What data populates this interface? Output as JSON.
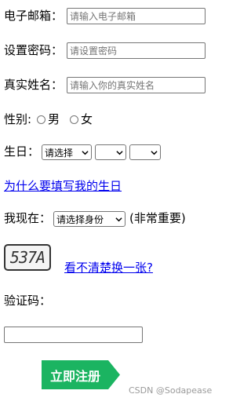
{
  "form": {
    "email": {
      "label": "电子邮箱：",
      "placeholder": "请输入电子邮箱",
      "value": ""
    },
    "password": {
      "label": "设置密码：",
      "placeholder": "请设置密码",
      "value": ""
    },
    "realname": {
      "label": "真实姓名：",
      "placeholder": "请输入你的真实姓名",
      "value": ""
    },
    "gender": {
      "label": "性别:",
      "options": [
        "男",
        "女"
      ],
      "selected": null
    },
    "birthday": {
      "label": "生日：",
      "year_select": "请选择",
      "month_select": "",
      "day_select": ""
    },
    "birthday_link": "为什么要填写我的生日",
    "identity": {
      "label": "我现在：",
      "select": "请选择身份",
      "note": "(非常重要)"
    },
    "captcha": {
      "image_text": "537A",
      "refresh_link": "看不清楚换一张?",
      "label": "验证码：",
      "value": ""
    },
    "submit_label": "立即注册"
  },
  "watermark": "CSDN @Sodapease",
  "colors": {
    "link": "#0000ee",
    "button": "#1bb461",
    "border": "#767676"
  },
  "icons": {
    "select_chevron": "chevron-down-icon",
    "radio": "radio-circle"
  }
}
